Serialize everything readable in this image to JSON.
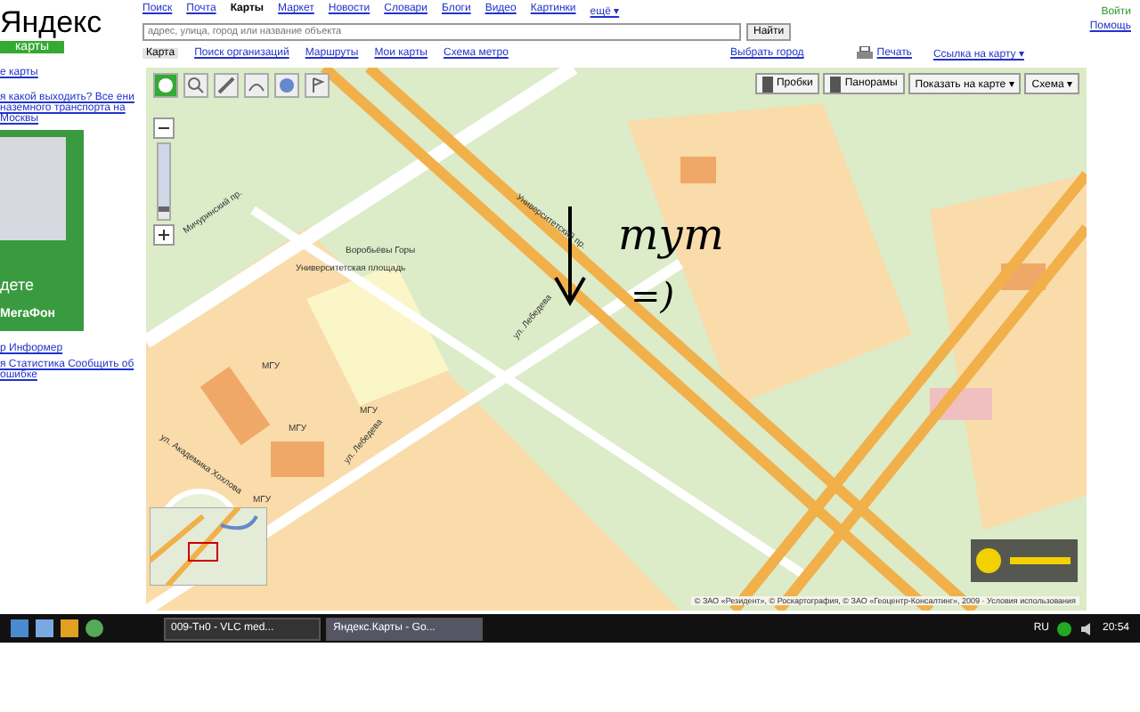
{
  "logo": {
    "brand": "Яндекс",
    "service": "карты"
  },
  "nav": [
    {
      "label": "Поиск",
      "selected": false
    },
    {
      "label": "Почта",
      "selected": false
    },
    {
      "label": "Карты",
      "selected": true
    },
    {
      "label": "Маркет",
      "selected": false
    },
    {
      "label": "Новости",
      "selected": false
    },
    {
      "label": "Словари",
      "selected": false
    },
    {
      "label": "Блоги",
      "selected": false
    },
    {
      "label": "Видео",
      "selected": false
    },
    {
      "label": "Картинки",
      "selected": false
    },
    {
      "label": "ещё ▾",
      "selected": false
    }
  ],
  "account": {
    "login": "Войти",
    "help": "Помощь"
  },
  "search": {
    "placeholder": "адрес, улица, город или название объекта",
    "button": "Найти"
  },
  "tabs": [
    {
      "label": "Карта",
      "selected": true
    },
    {
      "label": "Поиск организаций",
      "selected": false
    },
    {
      "label": "Маршруты",
      "selected": false
    },
    {
      "label": "Мои карты",
      "selected": false
    },
    {
      "label": "Схема метро",
      "selected": false
    }
  ],
  "city_link": "Выбрать город",
  "print": "Печать",
  "map_link": "Ссылка на карту ▾",
  "sidebar": {
    "links": [
      "е карты",
      "я какой выходить? Все ени наземного транспорта на Москвы"
    ],
    "ad_text": "дете",
    "ad_brand": "МегаФон",
    "footer_1": "р Информер",
    "footer_2": "я Статистика Сообщить об ошибке"
  },
  "map_controls": [
    "Пробки",
    "Панорамы",
    "Показать на карте ▾",
    "Схема ▾"
  ],
  "zoom": {
    "level": 0.9
  },
  "map_labels": [
    "Мичуринский пр.",
    "Воробьёвы Горы",
    "Университетская площадь",
    "ул. Лебедева",
    "ул. Лебедева",
    "ул. Академика Хохлова",
    "МГУ",
    "МГУ",
    "МГУ",
    "МГУ",
    "Университетский пр."
  ],
  "annotation": {
    "word": "тут",
    "smile": "=)"
  },
  "copyright": "© ЗАО «Резидент», © Роскартография, © ЗАО «Геоцентр-Консалтинг», 2009 · Условия использования",
  "taskbar": {
    "windows": [
      {
        "title": "009-Тн0 - VLC med...",
        "selected": false
      },
      {
        "title": "Яндекс.Карты - Go...",
        "selected": true
      }
    ],
    "language": "RU",
    "clock": "20:54"
  }
}
